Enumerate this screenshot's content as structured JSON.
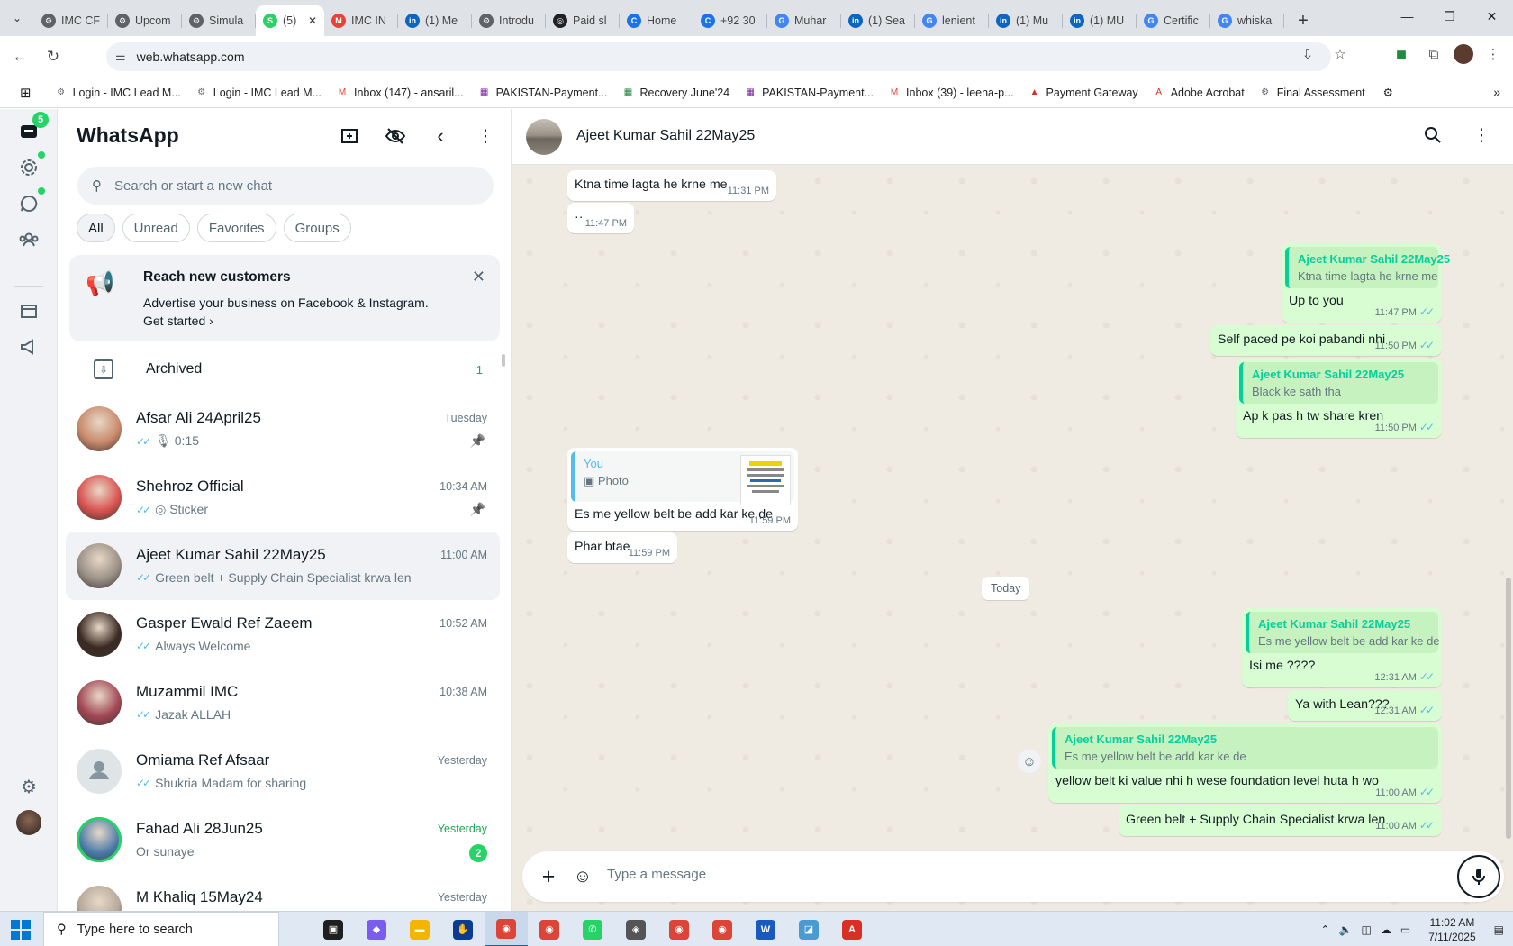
{
  "browser": {
    "tabs": [
      {
        "title": "IMC CF",
        "color": "#5f6368",
        "glyph": "⚙"
      },
      {
        "title": "Upcom",
        "color": "#5f6368",
        "glyph": "⚙"
      },
      {
        "title": "Simula",
        "color": "#5f6368",
        "glyph": "⚙"
      },
      {
        "title": "(5)",
        "color": "#25d366",
        "glyph": "S",
        "active": true
      },
      {
        "title": "IMC IN",
        "color": "#ea4335",
        "glyph": "M"
      },
      {
        "title": "(1) Me",
        "color": "#0a66c2",
        "glyph": "in"
      },
      {
        "title": "Introdu",
        "color": "#5f6368",
        "glyph": "⚙"
      },
      {
        "title": "Paid sl",
        "color": "#202124",
        "glyph": "◎"
      },
      {
        "title": "Home",
        "color": "#1a73e8",
        "glyph": "C"
      },
      {
        "title": "+92 30",
        "color": "#1a73e8",
        "glyph": "C"
      },
      {
        "title": "Muhar",
        "color": "#4285f4",
        "glyph": "G"
      },
      {
        "title": "(1) Sea",
        "color": "#0a66c2",
        "glyph": "in"
      },
      {
        "title": "lenient",
        "color": "#4285f4",
        "glyph": "G"
      },
      {
        "title": "(1) Mu",
        "color": "#0a66c2",
        "glyph": "in"
      },
      {
        "title": "(1) MU",
        "color": "#0a66c2",
        "glyph": "in"
      },
      {
        "title": "Certific",
        "color": "#4285f4",
        "glyph": "G"
      },
      {
        "title": "whiska",
        "color": "#4285f4",
        "glyph": "G"
      }
    ],
    "url": "web.whatsapp.com",
    "bookmarks": [
      {
        "label": "Login - IMC Lead M...",
        "color": "#5f6368",
        "icon": "⚙"
      },
      {
        "label": "Login - IMC Lead M...",
        "color": "#5f6368",
        "icon": "⚙"
      },
      {
        "label": "Inbox (147) - ansaril...",
        "color": "#ea4335",
        "icon": "M"
      },
      {
        "label": "PAKISTAN-Payment...",
        "color": "#7b1fa2",
        "icon": "▦"
      },
      {
        "label": "Recovery June'24",
        "color": "#188038",
        "icon": "▦"
      },
      {
        "label": "PAKISTAN-Payment...",
        "color": "#7b1fa2",
        "icon": "▦"
      },
      {
        "label": "Inbox (39) - leena-p...",
        "color": "#ea4335",
        "icon": "M"
      },
      {
        "label": "Payment Gateway",
        "color": "#d93025",
        "icon": "▲"
      },
      {
        "label": "Adobe Acrobat",
        "color": "#d93025",
        "icon": "A"
      },
      {
        "label": "Final Assessment",
        "color": "#5f6368",
        "icon": "⚙"
      }
    ]
  },
  "rail": {
    "chats_badge": "5"
  },
  "sidebar": {
    "title": "WhatsApp",
    "search_placeholder": "Search or start a new chat",
    "filters": [
      "All",
      "Unread",
      "Favorites",
      "Groups"
    ],
    "promo": {
      "title": "Reach new customers",
      "text": "Advertise your business on Facebook & Instagram.",
      "link": "Get started ›"
    },
    "archived": {
      "label": "Archived",
      "count": "1"
    },
    "chats": [
      {
        "name": "Afsar Ali 24April25",
        "preview": "🎙 0:15",
        "time": "Tuesday",
        "pinned": true,
        "ticks": true,
        "avatar": "#c98a6b"
      },
      {
        "name": "Shehroz Official",
        "preview": "◎ Sticker",
        "time": "10:34 AM",
        "pinned": true,
        "ticks": true,
        "avatar": "#d9534f"
      },
      {
        "name": "Ajeet Kumar Sahil 22May25",
        "preview": "Green belt + Supply Chain Specialist krwa len",
        "time": "11:00 AM",
        "selected": true,
        "ticks": true,
        "avatar": "#9b9187"
      },
      {
        "name": "Gasper Ewald Ref Zaeem",
        "preview": "Always Welcome",
        "time": "10:52 AM",
        "ticks": true,
        "avatar": "#3a2a22"
      },
      {
        "name": "Muzammil IMC",
        "preview": "Jazak ALLAH",
        "time": "10:38 AM",
        "ticks": true,
        "avatar": "#a34855"
      },
      {
        "name": "Omiama Ref Afsaar",
        "preview": "Shukria Madam for sharing",
        "time": "Yesterday",
        "ticks": true,
        "avatar": "#dfe5e7",
        "placeholder": true
      },
      {
        "name": "Fahad Ali 28Jun25",
        "preview": "Or sunaye",
        "time": "Yesterday",
        "unread": "2",
        "avatar": "#4a79a8",
        "ring": true
      },
      {
        "name": "M Khaliq 15May24",
        "preview": "",
        "time": "Yesterday",
        "avatar": "#b5a99c"
      }
    ]
  },
  "conversation": {
    "name": "Ajeet Kumar Sahil 22May25",
    "composer_placeholder": "Type a message",
    "date_divider": "Today",
    "messages": {
      "m1": {
        "text": "Ktna time lagta he krne me",
        "time": "11:31 PM"
      },
      "m2": {
        "text": "··",
        "time": "11:47 PM"
      },
      "m3": {
        "quote_name": "Ajeet Kumar Sahil 22May25",
        "quote_text": "Ktna time lagta he krne me",
        "text": "Up to you",
        "time": "11:47 PM"
      },
      "m4": {
        "text": "Self paced pe koi pabandi nhi",
        "time": "11:50 PM"
      },
      "m5": {
        "quote_name": "Ajeet Kumar Sahil 22May25",
        "quote_text": "Black ke sath tha",
        "text": "Ap k pas h tw share kren",
        "time": "11:50 PM"
      },
      "m6": {
        "quote_name": "You",
        "quote_text": "Photo",
        "text": "Es me yellow belt be add kar ke de",
        "time": "11:59 PM"
      },
      "m7": {
        "text": "Phar btae",
        "time": "11:59 PM"
      },
      "m8": {
        "quote_name": "Ajeet Kumar Sahil 22May25",
        "quote_text": "Es me yellow belt be add kar ke de",
        "text": "Isi me ????",
        "time": "12:31 AM"
      },
      "m9": {
        "text": "Ya with Lean???",
        "time": "12:31 AM"
      },
      "m10": {
        "quote_name": "Ajeet Kumar Sahil 22May25",
        "quote_text": "Es me yellow belt be add kar ke de",
        "text": "yellow belt ki value nhi h wese foundation level huta h wo",
        "time": "11:00 AM"
      },
      "m11": {
        "text": "Green belt + Supply Chain Specialist krwa len",
        "time": "11:00 AM"
      }
    }
  },
  "taskbar": {
    "search_placeholder": "Type here to search",
    "apps": [
      {
        "name": "task-view",
        "color": "#1f1f1f",
        "glyph": "▣"
      },
      {
        "name": "copilot",
        "color": "#7a5cf0",
        "glyph": "◆"
      },
      {
        "name": "file-explorer",
        "color": "#f4b400",
        "glyph": "▬"
      },
      {
        "name": "app",
        "color": "#0a3d91",
        "glyph": "✋"
      },
      {
        "name": "chrome",
        "color": "#db4437",
        "glyph": "◉",
        "active": true
      },
      {
        "name": "chrome",
        "color": "#db4437",
        "glyph": "◉"
      },
      {
        "name": "whatsapp",
        "color": "#25d366",
        "glyph": "✆"
      },
      {
        "name": "app",
        "color": "#555555",
        "glyph": "◈"
      },
      {
        "name": "chrome",
        "color": "#db4437",
        "glyph": "◉"
      },
      {
        "name": "chrome",
        "color": "#db4437",
        "glyph": "◉"
      },
      {
        "name": "word",
        "color": "#185abd",
        "glyph": "W"
      },
      {
        "name": "app",
        "color": "#4a9bd1",
        "glyph": "◪"
      },
      {
        "name": "acrobat",
        "color": "#d93025",
        "glyph": "A"
      }
    ],
    "time": "11:02 AM",
    "date": "7/11/2025"
  }
}
